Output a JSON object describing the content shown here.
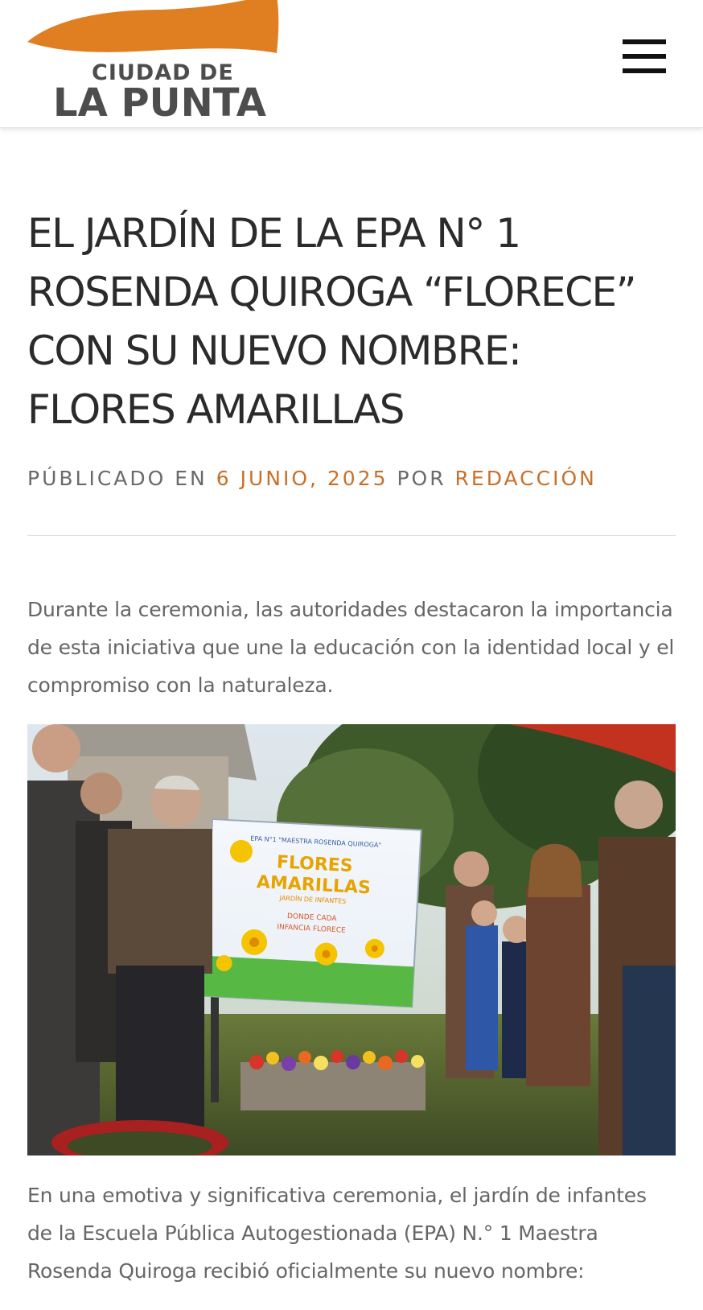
{
  "header": {
    "logo_line1": "CIUDAD DE",
    "logo_line2": "LA PUNTA",
    "logo_colors": {
      "flame": "#e07f22",
      "text": "#4d4d4d"
    },
    "menu_icon": "hamburger-menu-icon"
  },
  "article": {
    "title": "EL JARDÍN DE LA EPA N° 1 ROSENDA QUIROGA “FLORECE” CON SU NUEVO NOMBRE: FLORES AMARILLAS",
    "meta_prefix": "PÚBLICADO EN",
    "date": "6 JUNIO, 2025",
    "meta_by": "POR",
    "author": "REDACCIÓN",
    "paragraph1": "Durante la ceremonia, las autoridades destacaron la importancia de esta iniciativa que une la educación con la identidad local y el compromiso con la naturaleza.",
    "photo_sign": {
      "line1": "EPA N°1 \"MAESTRA ROSENDA QUIROGA\"",
      "line2": "FLORES",
      "line3": "AMARILLAS",
      "line4": "JARDÍN DE INFANTES",
      "line5": "DONDE CADA",
      "line6": "INFANCIA FLORECE"
    },
    "paragraph2": "En una emotiva y significativa ceremonia, el jardín de infantes de la Escuela Pública Autogestionada (EPA) N.° 1 Maestra Rosenda Quiroga recibió oficialmente su nuevo nombre:"
  },
  "colors": {
    "accent": "#c8702a",
    "title": "#2b2b2b",
    "body_text": "#666666"
  }
}
